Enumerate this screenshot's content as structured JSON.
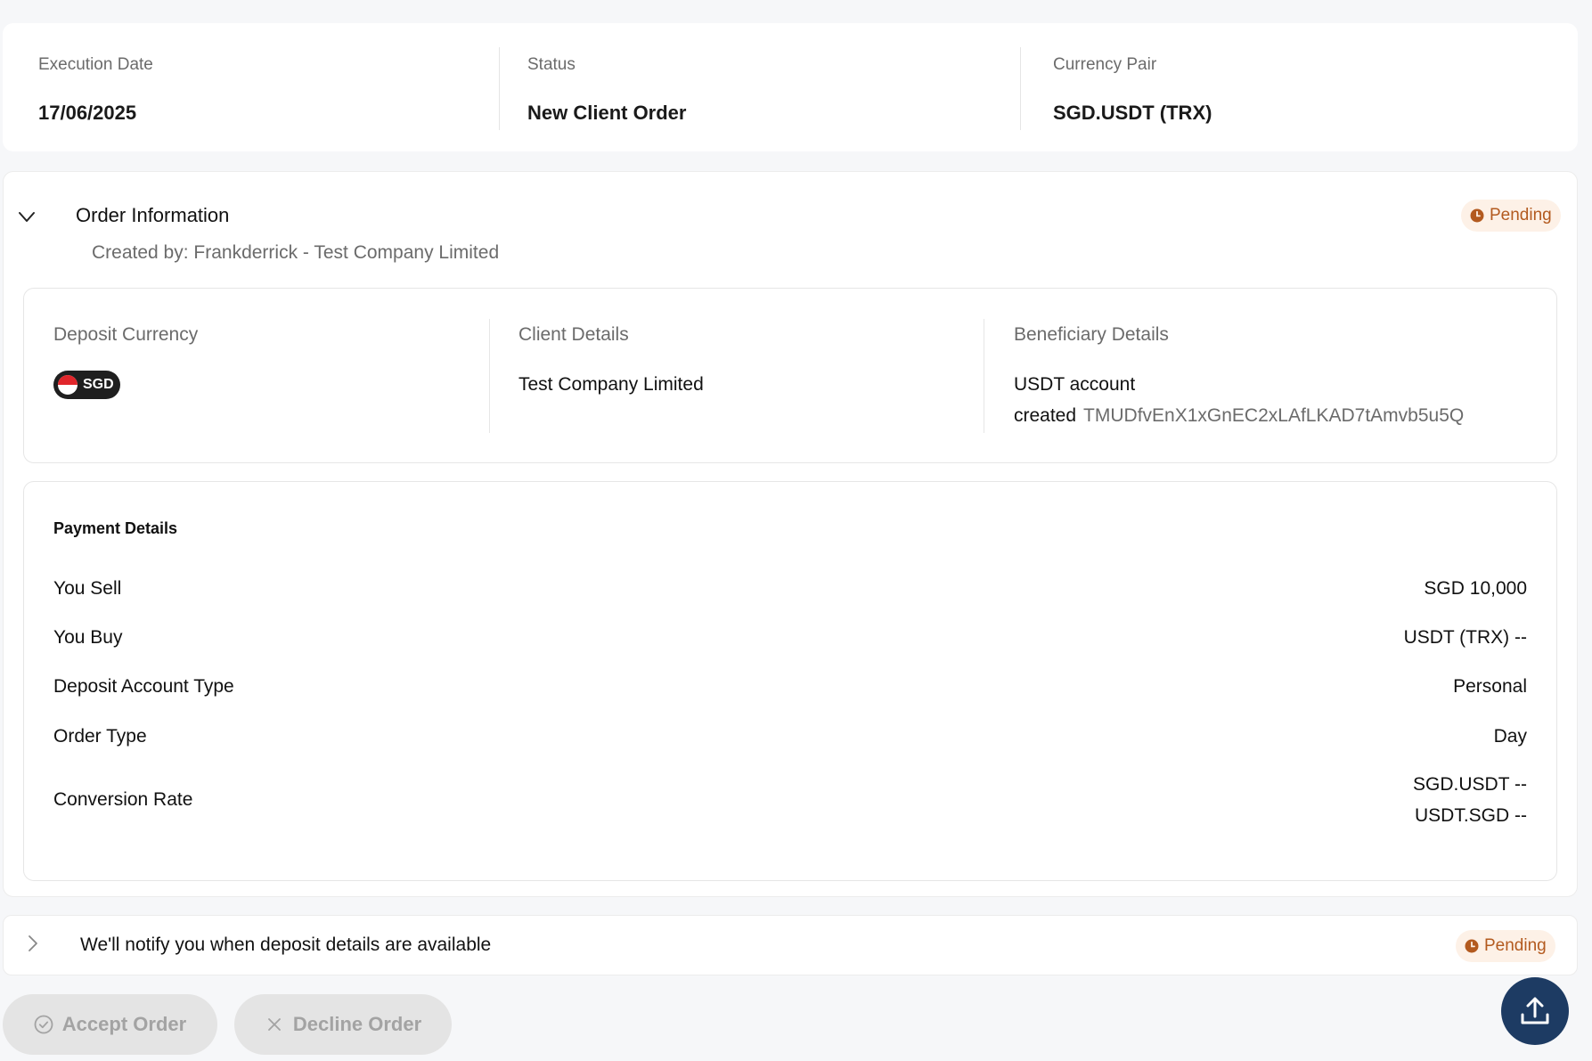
{
  "summary": {
    "execution_date_label": "Execution Date",
    "execution_date_value": "17/06/2025",
    "status_label": "Status",
    "status_value": "New Client Order",
    "currency_pair_label": "Currency Pair",
    "currency_pair_value": "SGD.USDT (TRX)"
  },
  "order_info": {
    "title": "Order Information",
    "created_by": "Created by: Frankderrick - Test Company Limited",
    "status_badge": "Pending",
    "deposit_currency_label": "Deposit Currency",
    "deposit_currency_code": "SGD",
    "client_details_label": "Client Details",
    "client_name": "Test Company Limited",
    "beneficiary_label": "Beneficiary Details",
    "beneficiary_line1": "USDT account",
    "beneficiary_created": "created",
    "beneficiary_address": "TMUDfvEnX1xGnEC2xLAfLKAD7tAmvb5u5Q"
  },
  "payment": {
    "title": "Payment Details",
    "rows": [
      {
        "label": "You Sell",
        "value": "SGD 10,000"
      },
      {
        "label": "You Buy",
        "value": "USDT (TRX) --"
      },
      {
        "label": "Deposit Account Type",
        "value": "Personal"
      },
      {
        "label": "Order Type",
        "value": "Day"
      }
    ],
    "conversion_label": "Conversion Rate",
    "conversion_line1": "SGD.USDT --",
    "conversion_line2": "USDT.SGD --"
  },
  "notify": {
    "text": "We'll notify you when deposit details are available",
    "status_badge": "Pending"
  },
  "actions": {
    "accept_label": "Accept Order",
    "decline_label": "Decline Order"
  },
  "colors": {
    "pending_text": "#b35a1f",
    "pending_bg": "#fdf1e7",
    "fab_bg": "#1d3b63",
    "button_disabled_bg": "#e4e4e4"
  },
  "icons": {
    "collapse": "chevron-down-icon",
    "expand": "chevron-right-icon",
    "pending": "clock-icon",
    "accept": "check-circle-icon",
    "decline": "close-icon",
    "fab": "upload-icon",
    "flag": "singapore-flag-icon"
  }
}
